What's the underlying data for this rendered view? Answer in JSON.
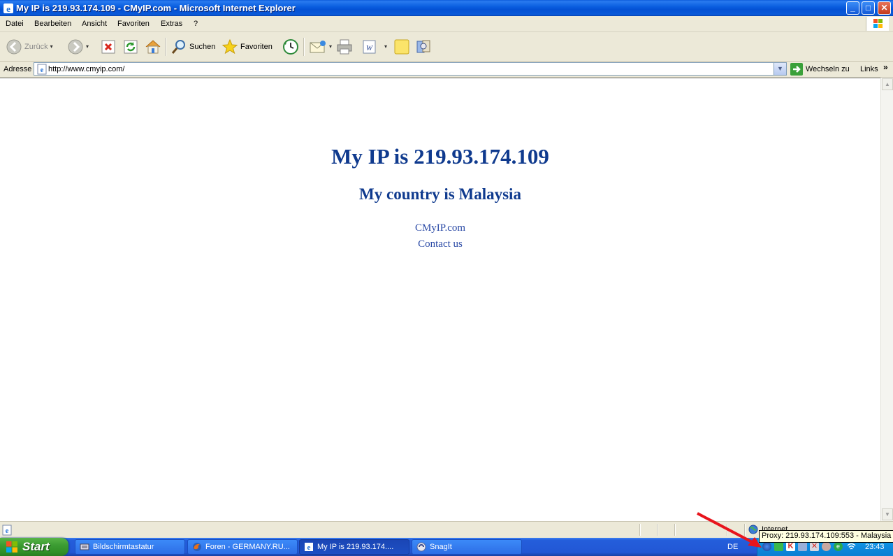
{
  "window": {
    "title": "My IP is 219.93.174.109 - CMyIP.com - Microsoft Internet Explorer",
    "min": "_",
    "max": "□",
    "close": "✕"
  },
  "menu": {
    "items": [
      "Datei",
      "Bearbeiten",
      "Ansicht",
      "Favoriten",
      "Extras",
      "?"
    ]
  },
  "toolbar": {
    "back_label": "Zurück",
    "search_label": "Suchen",
    "favorites_label": "Favoriten"
  },
  "address": {
    "label": "Adresse",
    "url": "http://www.cmyip.com/",
    "go_label": "Wechseln zu",
    "links_label": "Links",
    "links_chevron": "»"
  },
  "page": {
    "heading": "My IP is 219.93.174.109",
    "subheading": "My country is Malaysia",
    "links": [
      "CMyIP.com",
      "Contact us"
    ]
  },
  "status": {
    "zone": "Internet"
  },
  "tooltip": {
    "text": "Proxy: 219.93.174.109:553 - Malaysia"
  },
  "taskbar": {
    "start_label": "Start",
    "tasks": [
      {
        "label": "Bildschirmtastatur",
        "active": false
      },
      {
        "label": "Foren - GERMANY.RU...",
        "active": false
      },
      {
        "label": "My IP is 219.93.174....",
        "active": true
      },
      {
        "label": "SnagIt",
        "active": false
      }
    ],
    "language": "DE",
    "clock": "23:43"
  },
  "colors": {
    "heading": "#0f3a8e",
    "link": "#2b4aa6",
    "arrow": "#e8141c"
  }
}
